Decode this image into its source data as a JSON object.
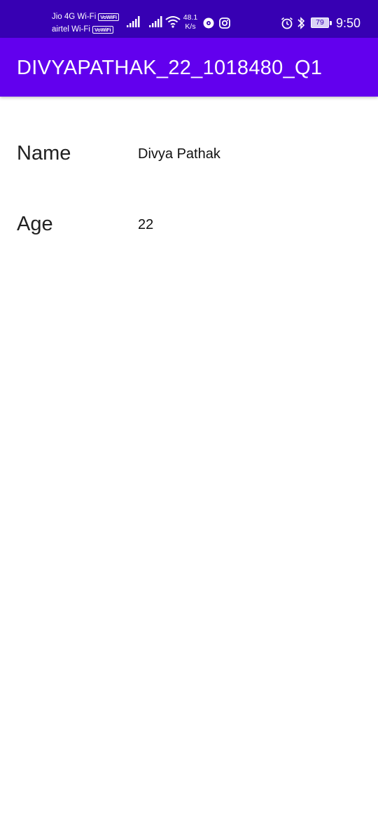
{
  "status_bar": {
    "carrier_1": "Jio 4G Wi-Fi",
    "carrier_2": "airtel Wi-Fi",
    "vowifi_badge": "VoWiFi",
    "speed_value": "48.1",
    "speed_unit": "K/s",
    "battery": "79",
    "time": "9:50",
    "icons": [
      "signal-icon",
      "signal-icon",
      "wifi-icon",
      "media-icon",
      "instagram-icon",
      "alarm-icon",
      "bluetooth-icon",
      "battery-icon"
    ]
  },
  "app_bar": {
    "title": "DIVYAPATHAK_22_1018480_Q1"
  },
  "profile": {
    "name_label": "Name",
    "name_value": "Divya Pathak",
    "age_label": "Age",
    "age_value": "22"
  },
  "colors": {
    "status_bar": "#3700b3",
    "app_bar": "#6200ee",
    "background": "#ffffff"
  }
}
